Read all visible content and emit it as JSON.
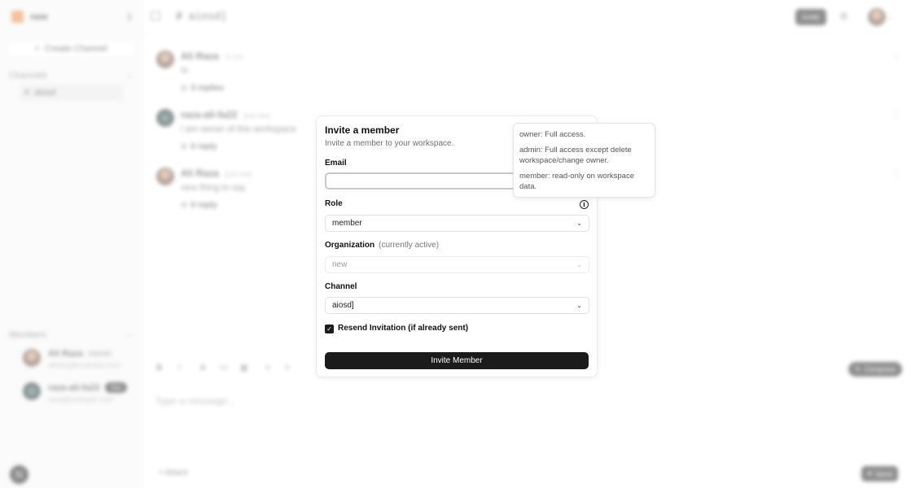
{
  "workspace": {
    "name": "new",
    "logo_color": "#e8833a"
  },
  "sidebar": {
    "create_channel": "Create Channel",
    "channels_title": "Channels",
    "channels": [
      {
        "label": "aiosd"
      }
    ],
    "members_title": "Members",
    "members": [
      {
        "name": "Ali Raza",
        "role": "owner",
        "email": "aliraza@example.com",
        "badge": ""
      },
      {
        "name": "raza-ali-fa22",
        "role": "",
        "email": "raza@example.com",
        "badge": "You"
      }
    ],
    "n_logo": "N"
  },
  "topbar": {
    "channel_title": "# aiosd]",
    "invite_label": "Invite"
  },
  "messages": [
    {
      "author": "Ali Raza",
      "time": "3 min",
      "text": "hi",
      "replies": "3 replies"
    },
    {
      "author": "raza-ali-fa22",
      "time": "just now",
      "text": "i am owner of this workspace",
      "replies": "0 reply"
    },
    {
      "author": "Ali Raza",
      "time": "just now",
      "text": "nice thing to say",
      "replies": "0 reply"
    }
  ],
  "composer": {
    "tools": [
      "B",
      "I",
      "S",
      "<>",
      "▦",
      "≡",
      "≡"
    ],
    "compose_label": "Compose",
    "placeholder": "Type a message...",
    "attach_label": "Attach",
    "send_label": "Send"
  },
  "modal": {
    "title": "Invite a member",
    "subtitle": "Invite a member to your workspace.",
    "email_label": "Email",
    "email_value": "",
    "role_label": "Role",
    "role_value": "member",
    "org_label": "Organization",
    "org_note": "(currently active)",
    "org_value": "new",
    "channel_label": "Channel",
    "channel_value": "aiosd]",
    "resend_label": "Resend Invitation (if already sent)",
    "resend_checked": true,
    "submit_label": "Invite Member"
  },
  "tooltip": {
    "owner": "owner: Full access.",
    "admin": "admin: Full access except delete workspace/change owner.",
    "member": "member: read-only on workspace data."
  }
}
